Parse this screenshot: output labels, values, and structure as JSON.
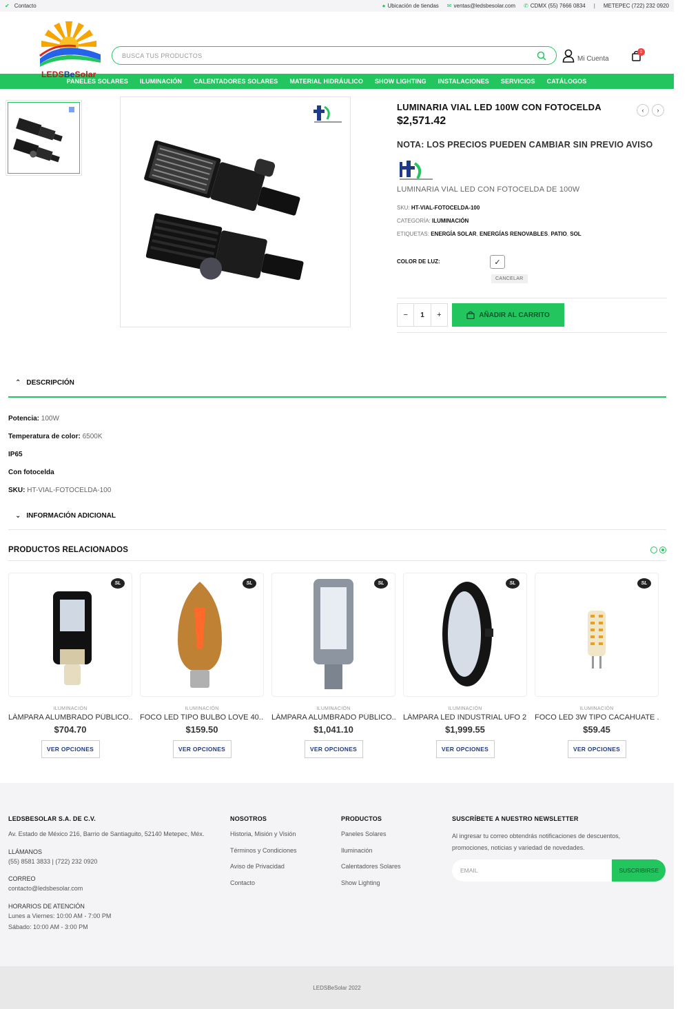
{
  "topbar": {
    "contact": "Contacto",
    "stores": "Ubicación de tiendas",
    "email": "ventas@ledsbesolar.com",
    "phone_cdmx": "CDMX (55) 7666 0834",
    "separator": "|",
    "phone_metepec": "METEPEC (722) 232 0920"
  },
  "header": {
    "logo_text_a": "LEDS",
    "logo_text_b": "Be",
    "logo_text_c": "Solar",
    "search_placeholder": "BUSCA TUS PRODUCTOS",
    "account_label": "Mi Cuenta",
    "cart_count": "0"
  },
  "nav": {
    "items": [
      "PANELES SOLARES",
      "ILUMINACIÓN",
      "CALENTADORES SOLARES",
      "MATERIAL HIDRÁULICO",
      "SHOW LIGHTING",
      "INSTALACIONES",
      "SERVICIOS",
      "CATÁLOGOS"
    ]
  },
  "product": {
    "title": "LUMINARIA VIAL LED 100W CON FOTOCELDA",
    "price": "$2,571.42",
    "note": "NOTA: LOS PRECIOS PUEDEN CAMBIAR SIN PREVIO AVISO",
    "subtitle": "LUMINARIA VIAL LED CON FOTOCELDA DE 100W",
    "sku_label": "SKU:",
    "sku": "HT-VIAL-FOTOCELDA-100",
    "category_label": "CATEGORÍA:",
    "category": "ILUMINACIÓN",
    "tags_label": "ETIQUETAS:",
    "tags": [
      "ENERGÍA SOLAR",
      "ENERGÍAS RENOVABLES",
      "PATIO",
      "SOL"
    ],
    "tag_separator": ",",
    "color_label": "COLOR DE LUZ:",
    "cancel": "CANCELAR",
    "qty": "1",
    "qty_minus": "−",
    "qty_plus": "+",
    "add_to_cart": "AÑADIR AL CARRITO",
    "prev_arrow": "‹",
    "next_arrow": "›",
    "swatch_check": "✓"
  },
  "description": {
    "heading": "DESCRIPCIÓN",
    "lines": [
      {
        "label": "Potencia:",
        "value": "100W"
      },
      {
        "label": "Temperatura de color:",
        "value": "6500K"
      },
      {
        "label": "IP65",
        "value": ""
      },
      {
        "label": "Con fotocelda",
        "value": ""
      },
      {
        "label": "SKU:",
        "value": "HT-VIAL-FOTOCELDA-100"
      }
    ],
    "additional_heading": "INFORMACIÓN ADICIONAL"
  },
  "related": {
    "heading": "PRODUCTOS RELACIONADOS",
    "badge": "SL",
    "button": "VER OPCIONES",
    "items": [
      {
        "category": "ILUMINACIÓN",
        "name": "LÁMPARA ALUMBRADO PÚBLICO...",
        "price": "$704.70"
      },
      {
        "category": "ILUMINACIÓN",
        "name": "FOCO LED TIPO BULBO LOVE 40...",
        "price": "$159.50"
      },
      {
        "category": "ILUMINACIÓN",
        "name": "LÁMPARA ALUMBRADO PÚBLICO...",
        "price": "$1,041.10"
      },
      {
        "category": "ILUMINACIÓN",
        "name": "LÁMPARA LED INDUSTRIAL UFO 2...",
        "price": "$1,999.55"
      },
      {
        "category": "ILUMINACIÓN",
        "name": "FOCO LED 3W TIPO CACAHUATE ...",
        "price": "$59.45"
      }
    ]
  },
  "footer": {
    "company": {
      "title": "LEDSBESOLAR S.A. DE C.V.",
      "address": "Av. Estado de México 216, Barrio de Santiaguito, 52140 Metepec, Méx.",
      "call_label": "LLÁMANOS",
      "call": "(55) 8581 3833 | (722) 232 0920",
      "mail_label": "CORREO",
      "mail": "contacto@ledsbesolar.com",
      "hours_label": "HORARIOS DE ATENCIÓN",
      "hours_week": "Lunes a Viernes: 10:00 AM - 7:00 PM",
      "hours_sat": "Sábado: 10:00 AM - 3:00 PM"
    },
    "nosotros": {
      "title": "NOSOTROS",
      "links": [
        "Historia, Misión y Visión",
        "Términos y Condiciones",
        "Aviso de Privacidad",
        "Contacto"
      ]
    },
    "productos": {
      "title": "PRODUCTOS",
      "links": [
        "Paneles Solares",
        "Iluminación",
        "Calentadores Solares",
        "Show Lighting"
      ]
    },
    "newsletter": {
      "title": "SUSCRÍBETE A NUESTRO NEWSLETTER",
      "text": "Al ingresar tu correo obtendrás notificaciones de descuentos, promociones, noticias y variedad de novedades.",
      "placeholder": "EMAIL",
      "button": "SUSCRIBIRSE"
    },
    "copyright": "LEDSBeSolar 2022"
  },
  "colors": {
    "accent": "#22c55e",
    "dark": "#111111"
  }
}
